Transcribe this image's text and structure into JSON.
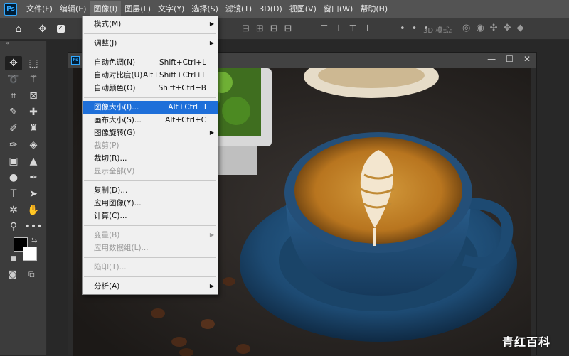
{
  "app": {
    "logo": "Ps"
  },
  "menubar": {
    "items": [
      "文件(F)",
      "编辑(E)",
      "图像(I)",
      "图层(L)",
      "文字(Y)",
      "选择(S)",
      "滤镜(T)",
      "3D(D)",
      "视图(V)",
      "窗口(W)",
      "帮助(H)"
    ],
    "active_index": 2
  },
  "optionsbar": {
    "mode_label": "3D 模式:"
  },
  "image_menu": {
    "items": [
      {
        "label": "模式(M)",
        "shortcut": "",
        "submenu": true,
        "disabled": false
      },
      {
        "sep": true
      },
      {
        "label": "调整(J)",
        "shortcut": "",
        "submenu": true,
        "disabled": false
      },
      {
        "sep": true
      },
      {
        "label": "自动色调(N)",
        "shortcut": "Shift+Ctrl+L",
        "submenu": false,
        "disabled": false
      },
      {
        "label": "自动对比度(U)",
        "shortcut": "Alt+Shift+Ctrl+L",
        "submenu": false,
        "disabled": false
      },
      {
        "label": "自动颜色(O)",
        "shortcut": "Shift+Ctrl+B",
        "submenu": false,
        "disabled": false
      },
      {
        "sep": true
      },
      {
        "label": "图像大小(I)...",
        "shortcut": "Alt+Ctrl+I",
        "submenu": false,
        "disabled": false,
        "highlighted": true
      },
      {
        "label": "画布大小(S)...",
        "shortcut": "Alt+Ctrl+C",
        "submenu": false,
        "disabled": false
      },
      {
        "label": "图像旋转(G)",
        "shortcut": "",
        "submenu": true,
        "disabled": false
      },
      {
        "label": "裁剪(P)",
        "shortcut": "",
        "submenu": false,
        "disabled": true
      },
      {
        "label": "裁切(R)...",
        "shortcut": "",
        "submenu": false,
        "disabled": false
      },
      {
        "label": "显示全部(V)",
        "shortcut": "",
        "submenu": false,
        "disabled": true
      },
      {
        "sep": true
      },
      {
        "label": "复制(D)...",
        "shortcut": "",
        "submenu": false,
        "disabled": false
      },
      {
        "label": "应用图像(Y)...",
        "shortcut": "",
        "submenu": false,
        "disabled": false
      },
      {
        "label": "计算(C)...",
        "shortcut": "",
        "submenu": false,
        "disabled": false
      },
      {
        "sep": true
      },
      {
        "label": "变量(B)",
        "shortcut": "",
        "submenu": true,
        "disabled": true
      },
      {
        "label": "应用数据组(L)...",
        "shortcut": "",
        "submenu": false,
        "disabled": true
      },
      {
        "sep": true
      },
      {
        "label": "陷印(T)...",
        "shortcut": "",
        "submenu": false,
        "disabled": true
      },
      {
        "sep": true
      },
      {
        "label": "分析(A)",
        "shortcut": "",
        "submenu": true,
        "disabled": false
      }
    ]
  },
  "watermark": {
    "text": "青红百科"
  },
  "colors": {
    "highlight": "#1e6fd9",
    "menubar": "#535353",
    "panel": "#3c3c3c"
  }
}
